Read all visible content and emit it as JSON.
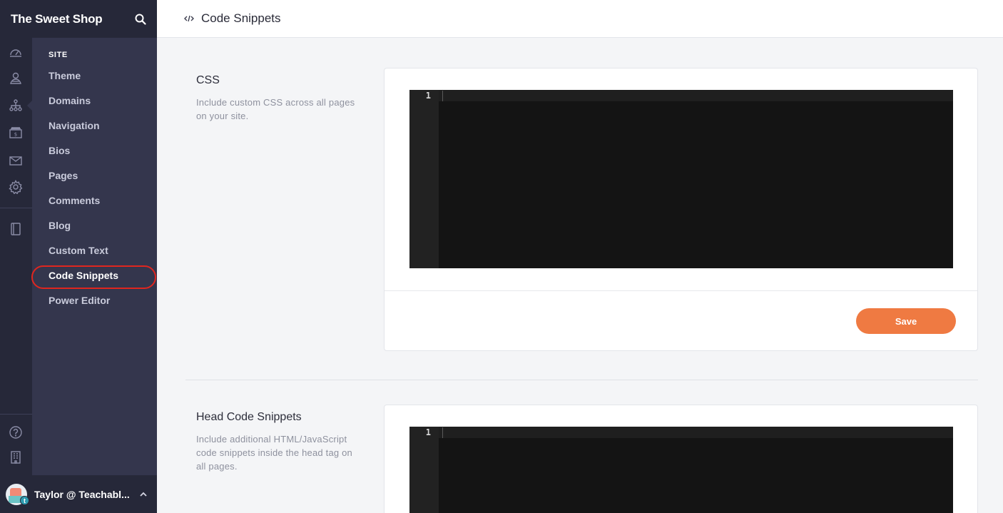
{
  "app": {
    "brand": "The Sweet Shop"
  },
  "submenu": {
    "heading": "SITE",
    "items": [
      {
        "label": "Theme"
      },
      {
        "label": "Domains"
      },
      {
        "label": "Navigation"
      },
      {
        "label": "Bios"
      },
      {
        "label": "Pages"
      },
      {
        "label": "Comments"
      },
      {
        "label": "Blog"
      },
      {
        "label": "Custom Text"
      },
      {
        "label": "Code Snippets",
        "active": true
      },
      {
        "label": "Power Editor"
      }
    ]
  },
  "rail_icons": [
    "dashboard-icon",
    "users-icon",
    "site-icon",
    "sales-icon",
    "email-icon",
    "settings-icon",
    "book-icon",
    "help-icon",
    "building-icon"
  ],
  "user": {
    "name": "Taylor @ Teachabl...",
    "badge": "t"
  },
  "header": {
    "title": "Code Snippets"
  },
  "css_section": {
    "title": "CSS",
    "description": "Include custom CSS across all pages on your site.",
    "line_number": "1",
    "save_label": "Save"
  },
  "head_section": {
    "title": "Head Code Snippets",
    "description": "Include additional HTML/JavaScript code snippets inside the head tag on all pages.",
    "line_number": "1"
  },
  "colors": {
    "accent": "#ef7a42",
    "sidebar": "#34364d",
    "sidebar_dark": "#262839",
    "highlight": "#e0261f"
  }
}
